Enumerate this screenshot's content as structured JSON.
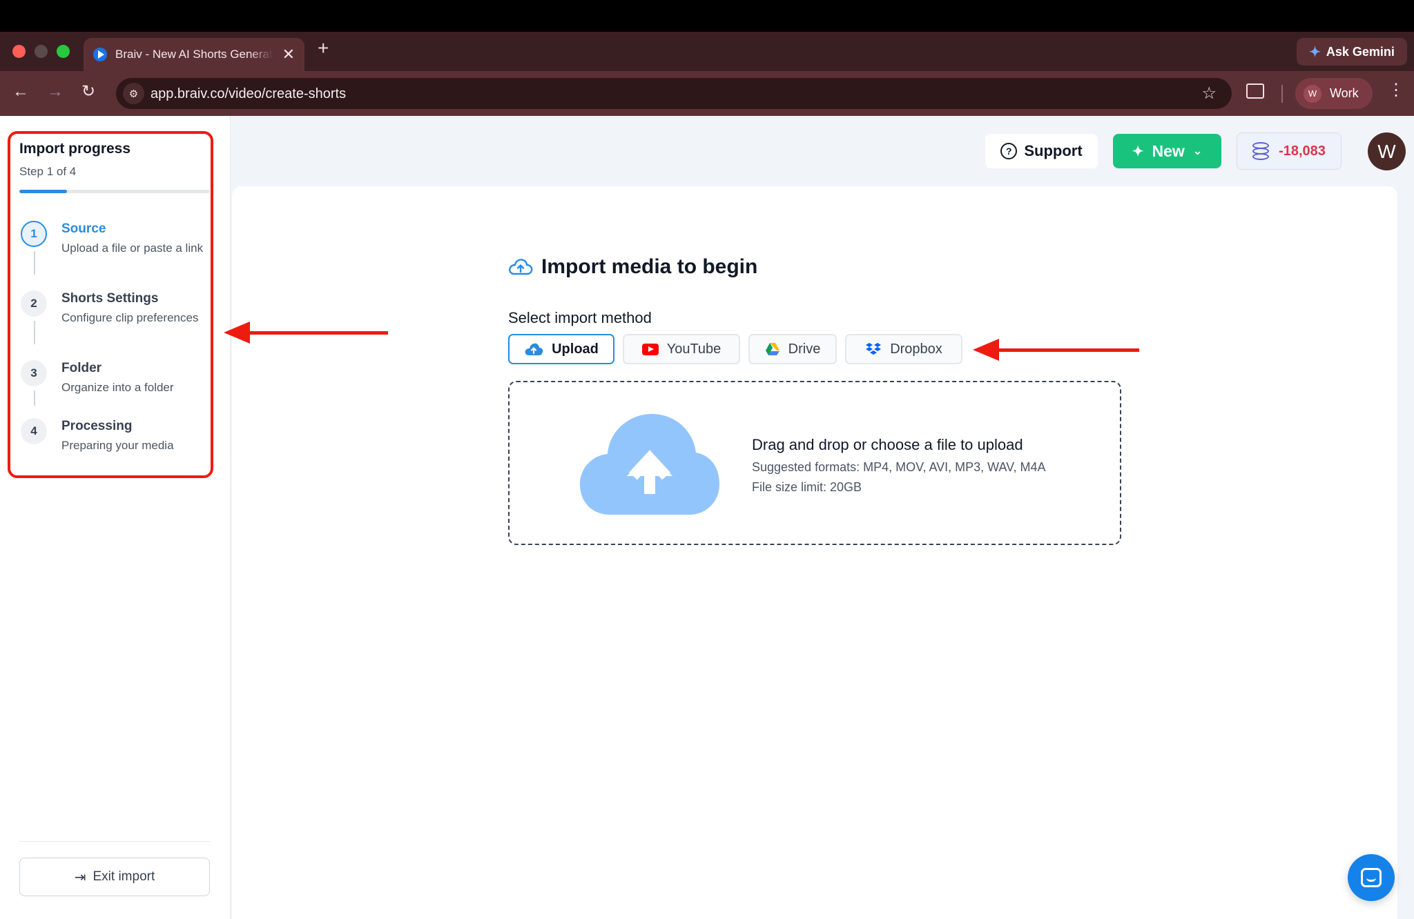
{
  "browser": {
    "tab_title": "Braiv - New AI Shorts Generator",
    "tab_close": "✕",
    "new_tab": "+",
    "ask_gemini": "Ask Gemini",
    "url": "app.braiv.co/video/create-shorts",
    "profile_initial": "W",
    "profile_label": "Work"
  },
  "sidebar": {
    "title": "Import progress",
    "step_indicator": "Step 1 of 4",
    "progress_fraction": 0.25,
    "steps": [
      {
        "number": "1",
        "title": "Source",
        "description": "Upload a file or paste a link",
        "active": true
      },
      {
        "number": "2",
        "title": "Shorts Settings",
        "description": "Configure clip preferences",
        "active": false
      },
      {
        "number": "3",
        "title": "Folder",
        "description": "Organize into a folder",
        "active": false
      },
      {
        "number": "4",
        "title": "Processing",
        "description": "Preparing your media",
        "active": false
      }
    ],
    "exit_label": "Exit import"
  },
  "header": {
    "support_label": "Support",
    "new_label": "New",
    "credits": "-18,083",
    "avatar_initial": "W"
  },
  "main": {
    "title": "Import media to begin",
    "select_label": "Select import method",
    "methods": [
      {
        "label": "Upload",
        "icon": "cloud-upload-icon",
        "selected": true
      },
      {
        "label": "YouTube",
        "icon": "youtube-icon",
        "selected": false
      },
      {
        "label": "Drive",
        "icon": "google-drive-icon",
        "selected": false
      },
      {
        "label": "Dropbox",
        "icon": "dropbox-icon",
        "selected": false
      }
    ],
    "dropzone": {
      "title": "Drag and drop or choose a file to upload",
      "formats": "Suggested formats: MP4, MOV, AVI, MP3, WAV, M4A",
      "limit": "File size limit: 20GB"
    }
  },
  "colors": {
    "accent": "#2a8be3",
    "new_button": "#19c37d",
    "credits": "#e0334d",
    "annotation": "#ee1b10"
  }
}
